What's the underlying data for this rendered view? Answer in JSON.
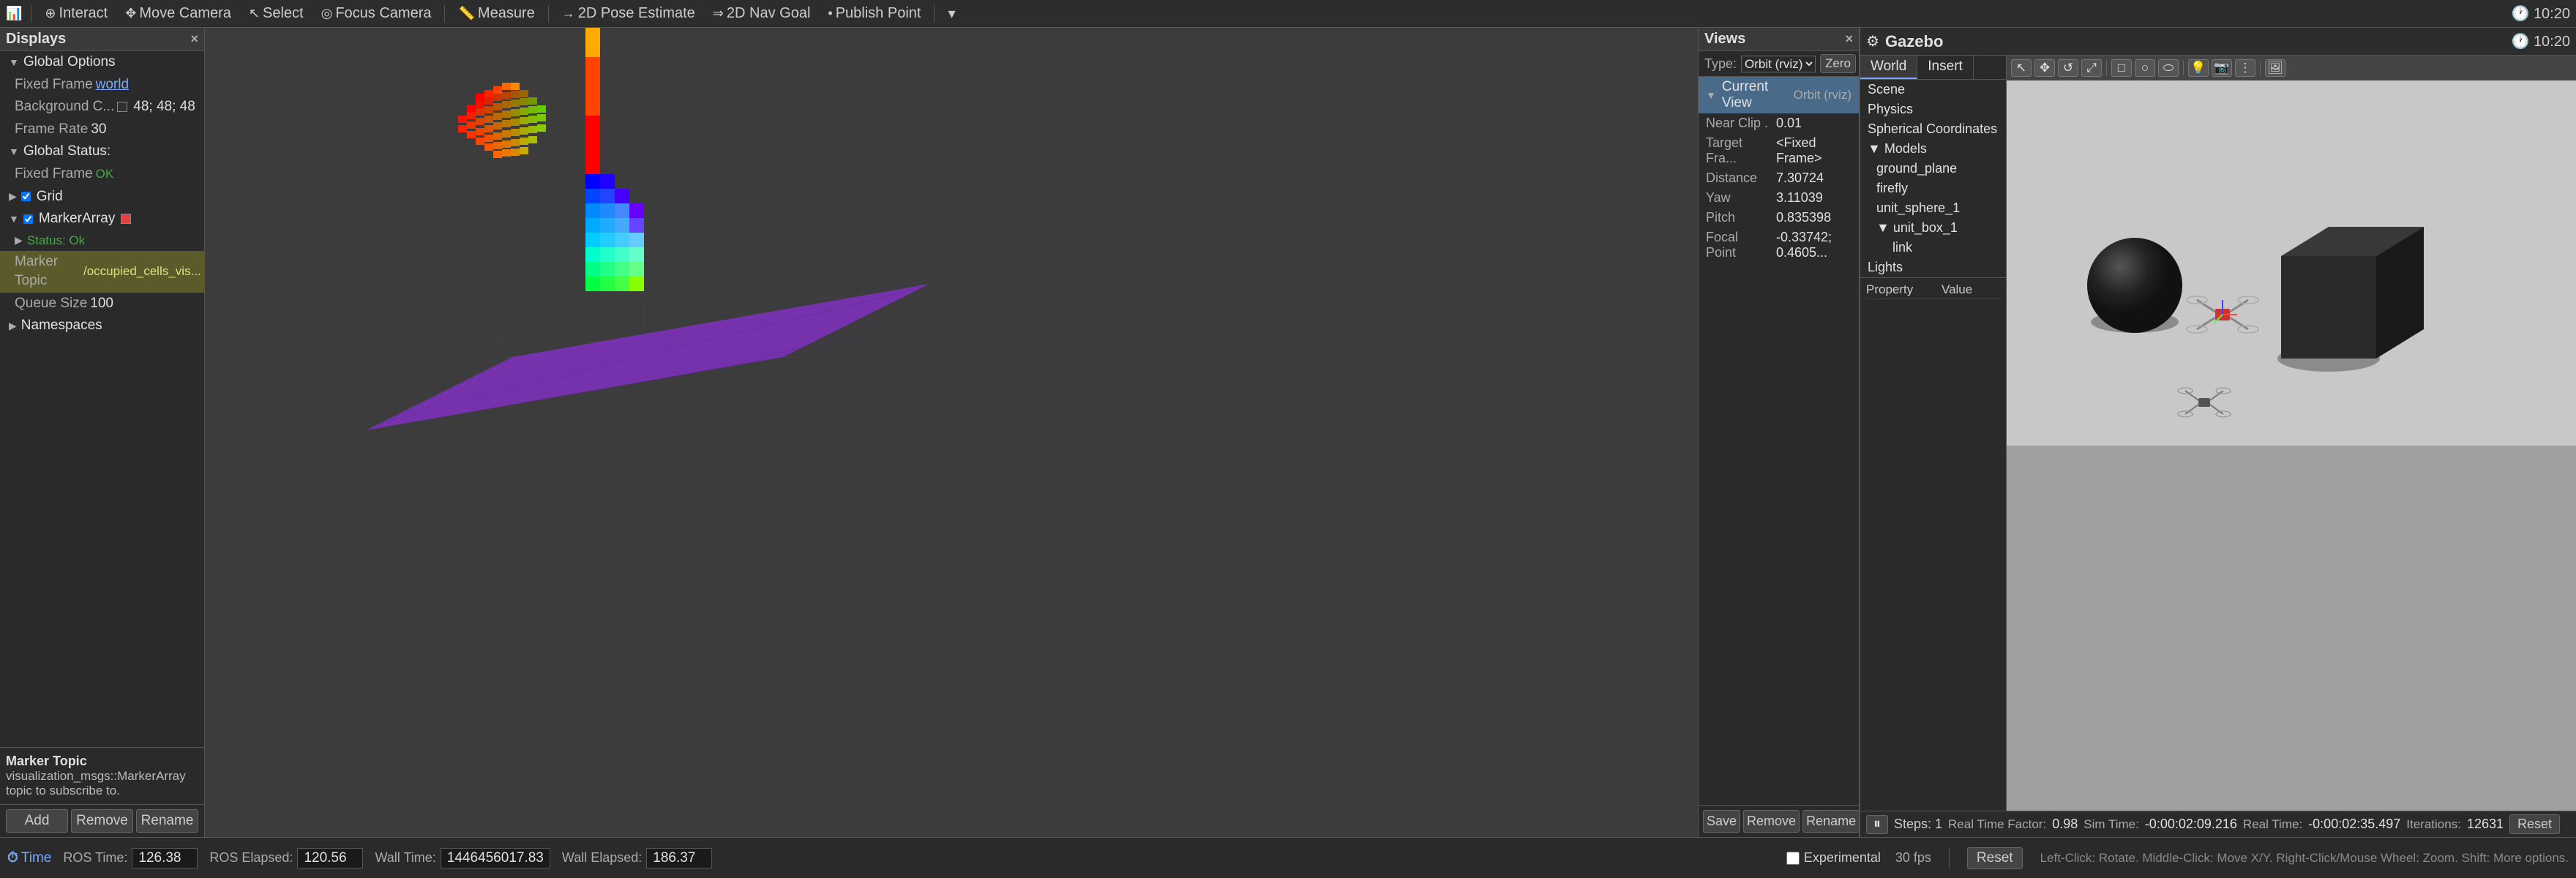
{
  "app": {
    "rviz_title": "RViz",
    "gazebo_title": "Gazebo",
    "clock": "10:20"
  },
  "toolbar": {
    "buttons": [
      {
        "label": "Interact",
        "icon": "⊕"
      },
      {
        "label": "Move Camera",
        "icon": "✥"
      },
      {
        "label": "Select",
        "icon": "↖"
      },
      {
        "label": "Focus Camera",
        "icon": "◎"
      },
      {
        "label": "Measure",
        "icon": "📏"
      },
      {
        "label": "2D Pose Estimate",
        "icon": "→"
      },
      {
        "label": "2D Nav Goal",
        "icon": "⇒"
      },
      {
        "label": "Publish Point",
        "icon": "•"
      }
    ]
  },
  "displays": {
    "title": "Displays",
    "items": [
      {
        "id": "global-options",
        "label": "Global Options",
        "indent": 0,
        "type": "group",
        "expanded": true
      },
      {
        "id": "fixed-frame",
        "label": "Fixed Frame",
        "indent": 1,
        "value": "world",
        "type": "kv"
      },
      {
        "id": "background-color",
        "label": "Background C...",
        "indent": 1,
        "value": "48; 48; 48",
        "type": "color",
        "color": "#303030"
      },
      {
        "id": "frame-rate",
        "label": "Frame Rate",
        "indent": 1,
        "value": "30",
        "type": "kv"
      },
      {
        "id": "global-status",
        "label": "Global Status:",
        "indent": 0,
        "type": "group",
        "expanded": true
      },
      {
        "id": "fixed-frame-status",
        "label": "Fixed Frame",
        "indent": 1,
        "value": "OK",
        "type": "status",
        "status": "ok"
      },
      {
        "id": "grid",
        "label": "Grid",
        "indent": 0,
        "type": "display",
        "checked": true
      },
      {
        "id": "marker-array",
        "label": "MarkerArray",
        "indent": 0,
        "type": "display",
        "checked": true,
        "expanded": true
      },
      {
        "id": "status",
        "label": "Status: Ok",
        "indent": 1,
        "type": "status",
        "status": "ok"
      },
      {
        "id": "marker-topic",
        "label": "Marker Topic",
        "indent": 1,
        "value": "/occupied_cells_vis...",
        "type": "kv",
        "selected": true
      },
      {
        "id": "queue-size",
        "label": "Queue Size",
        "indent": 1,
        "value": "100",
        "type": "kv"
      },
      {
        "id": "namespaces",
        "label": "Namespaces",
        "indent": 0,
        "type": "group"
      }
    ],
    "marker_topic_desc": {
      "label": "Marker Topic",
      "value": "visualization_msgs::MarkerArray topic to subscribe to."
    }
  },
  "views": {
    "title": "Views",
    "type_label": "Type:",
    "type_value": "Orbit (rviz)",
    "zero_btn": "Zero",
    "current_view_label": "Current View",
    "current_view_value": "Orbit (rviz)",
    "fields": [
      {
        "key": "Near Clip",
        "value": "0.01"
      },
      {
        "key": "Target Fra...",
        "value": "<Fixed Frame>"
      },
      {
        "key": "Distance",
        "value": "7.30724"
      },
      {
        "key": "Yaw",
        "value": "3.11039"
      },
      {
        "key": "Pitch",
        "value": "0.835398"
      },
      {
        "key": "Focal Point",
        "value": "-0.33742; 0.4605..."
      }
    ],
    "buttons": [
      "Save",
      "Remove",
      "Rename"
    ]
  },
  "gazebo": {
    "title": "Gazebo",
    "clock": "10:20",
    "tabs": [
      "World",
      "Insert"
    ],
    "active_tab": "World",
    "scene_items": [
      {
        "label": "Scene",
        "indent": 0
      },
      {
        "label": "Physics",
        "indent": 0
      },
      {
        "label": "Spherical Coordinates",
        "indent": 0
      },
      {
        "label": "Models",
        "indent": 0,
        "expanded": true
      },
      {
        "label": "ground_plane",
        "indent": 1
      },
      {
        "label": "firefly",
        "indent": 1
      },
      {
        "label": "unit_sphere_1",
        "indent": 1
      },
      {
        "label": "unit_box_1",
        "indent": 1,
        "expanded": true
      },
      {
        "label": "link",
        "indent": 2
      },
      {
        "label": "Lights",
        "indent": 0
      }
    ],
    "property_headers": [
      "Property",
      "Value"
    ],
    "bottom": {
      "play_icon": "⏸",
      "steps_label": "Steps: 1",
      "real_time_factor_label": "Real Time Factor:",
      "real_time_factor": "0.98",
      "sim_time_label": "Sim Time:",
      "sim_time": "-0:00:02:09.216",
      "real_time_label": "Real Time:",
      "real_time": "-0:00:02:35.497",
      "iterations_label": "Iterations:",
      "iterations": "12631",
      "reset_btn": "Reset"
    }
  },
  "bottom_bar": {
    "time_label": "Time",
    "ros_time_label": "ROS Time:",
    "ros_time": "126.38",
    "ros_elapsed_label": "ROS Elapsed:",
    "ros_elapsed": "120.56",
    "wall_time_label": "Wall Time:",
    "wall_time": "1446456017.83",
    "wall_elapsed_label": "Wall Elapsed:",
    "wall_elapsed": "186.37",
    "experimental_label": "Experimental",
    "reset_btn": "Reset",
    "mouse_hint": "Left-Click: Rotate.  Middle-Click: Move X/Y.  Right-Click/Mouse Wheel: Zoom.  Shift: More options.",
    "fps": "30 fps"
  }
}
